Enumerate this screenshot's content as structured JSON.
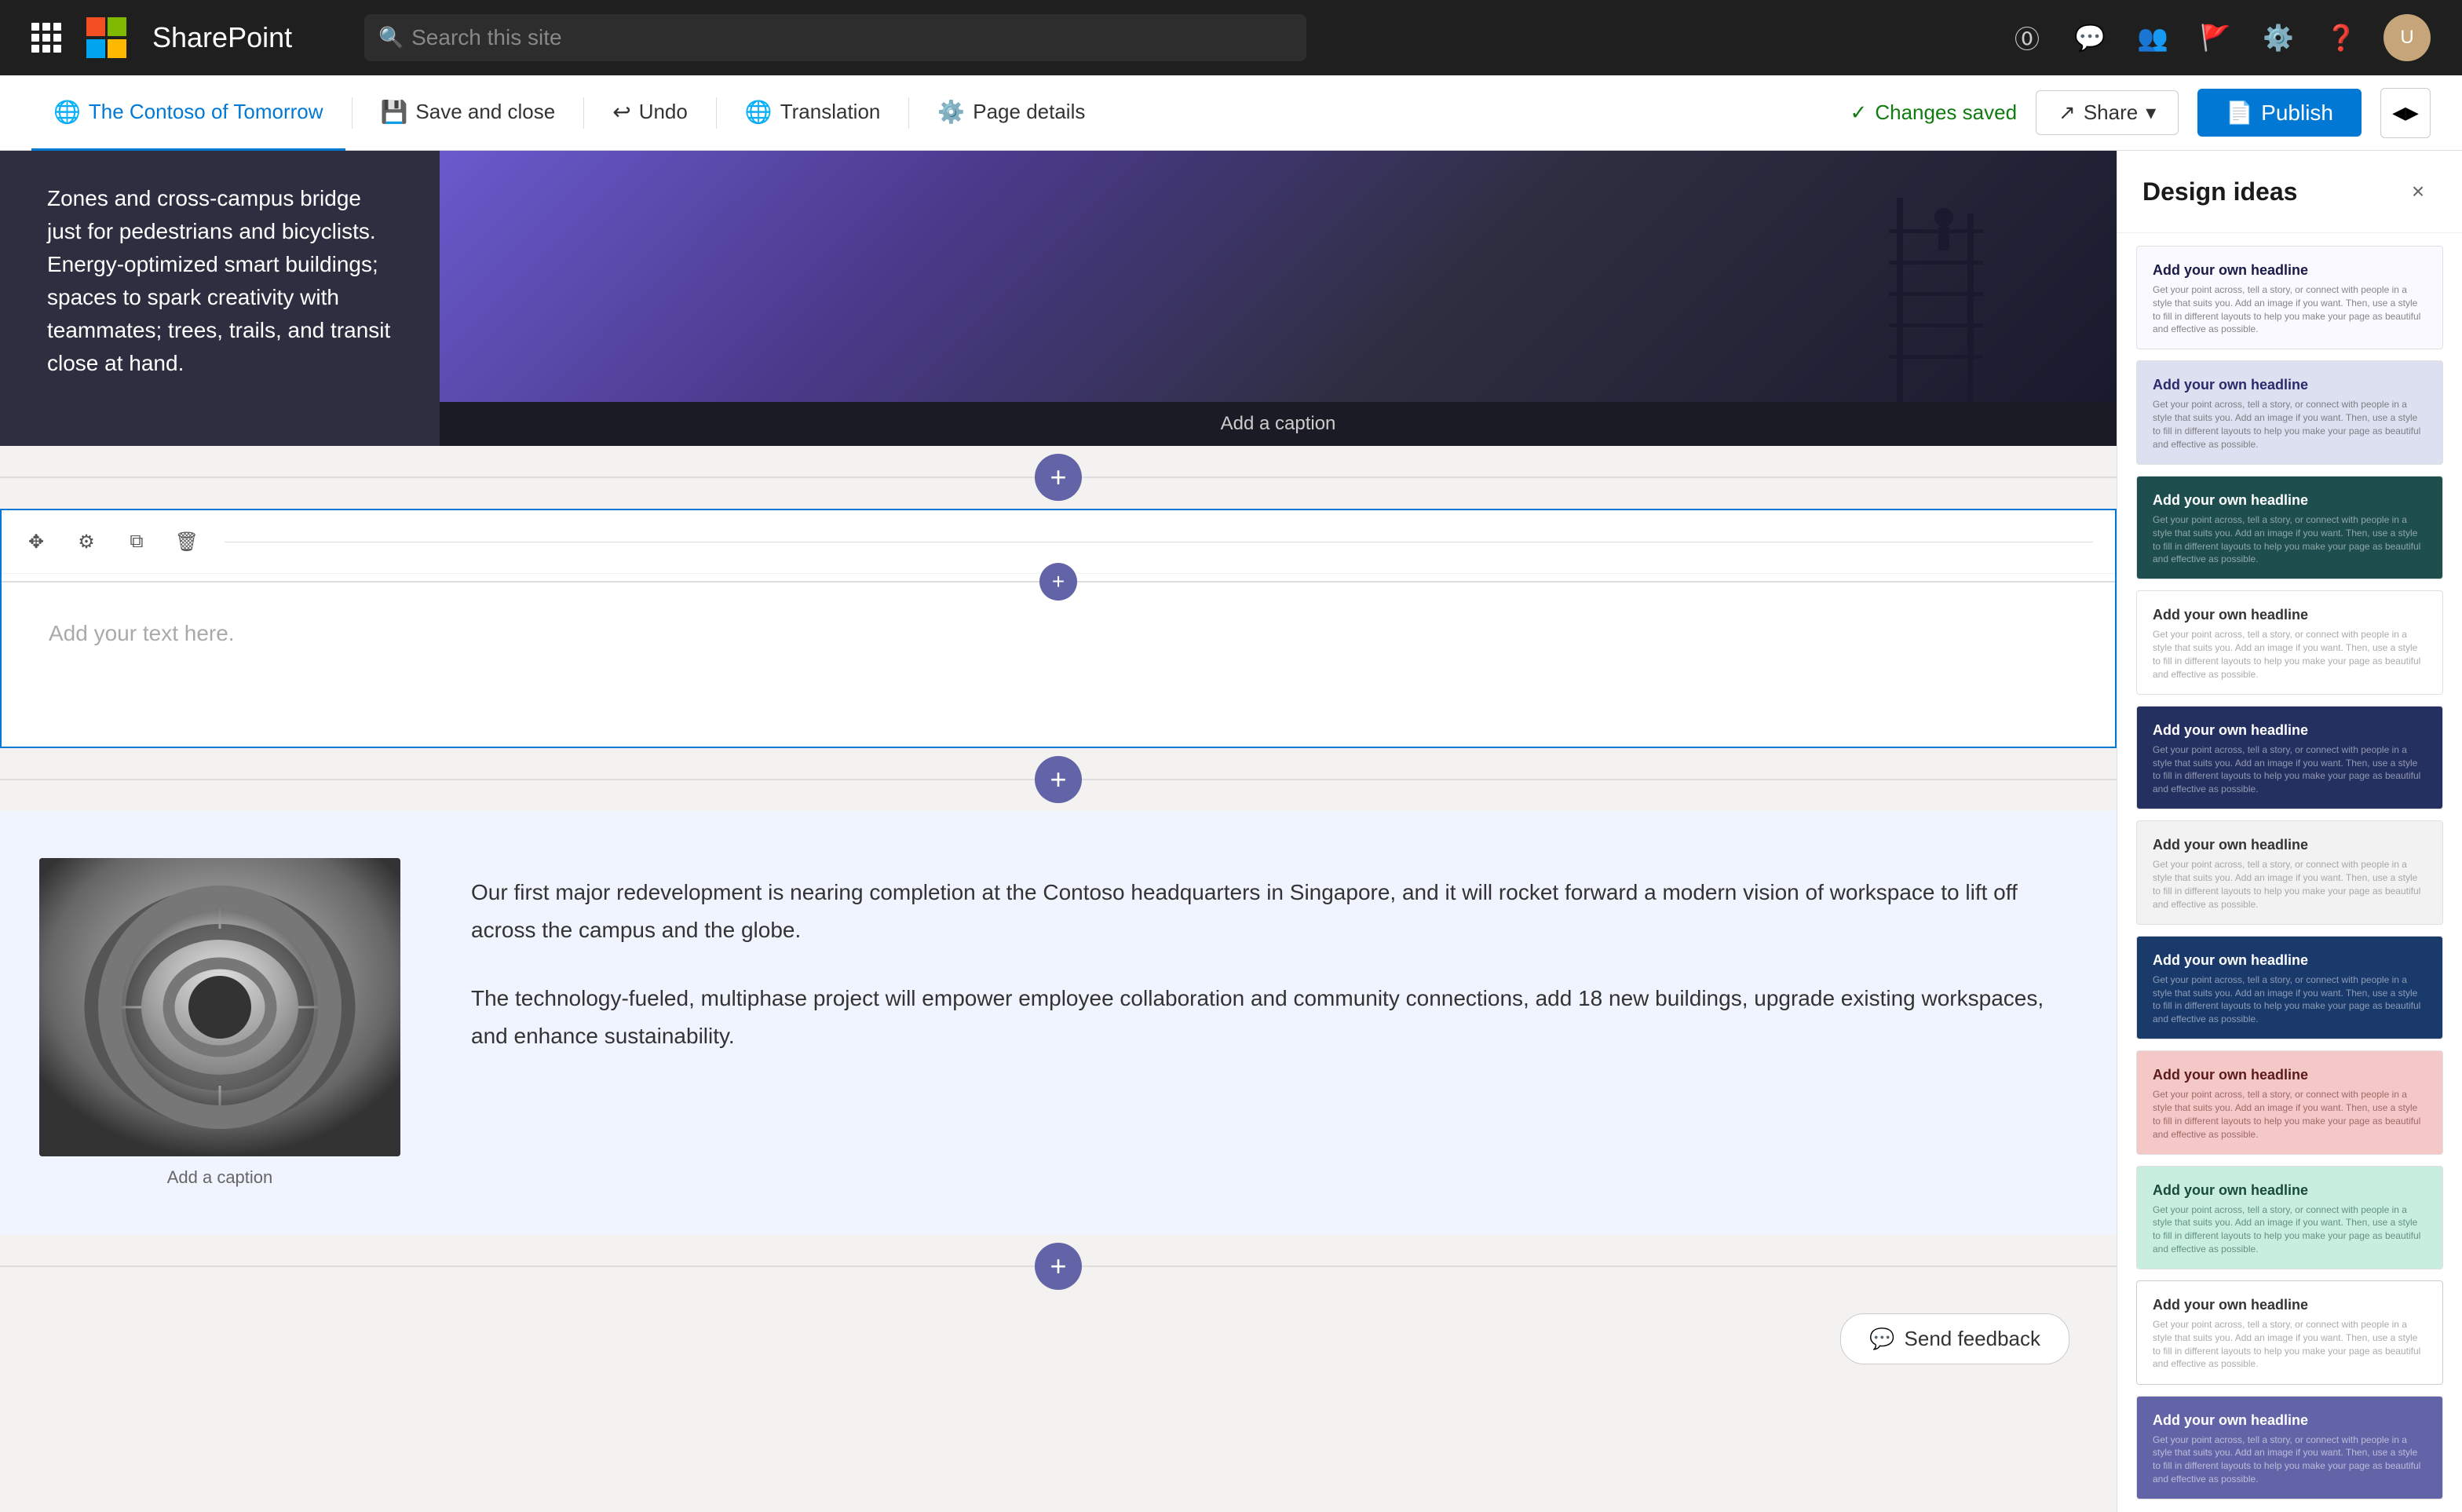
{
  "topnav": {
    "app_name": "SharePoint",
    "search_placeholder": "Search this site"
  },
  "toolbar": {
    "site_tab": "The Contoso of Tomorrow",
    "save_close_label": "Save and close",
    "undo_label": "Undo",
    "translation_label": "Translation",
    "page_details_label": "Page details",
    "changes_saved_label": "Changes saved",
    "share_label": "Share",
    "publish_label": "Publish"
  },
  "page": {
    "hero_text": "Zones and cross-campus bridge just for pedestrians and bicyclists. Energy-optimized smart buildings; spaces to spark creativity with teammates; trees, trails, and transit close at hand.",
    "hero_caption": "Add a caption",
    "text_placeholder": "Add your text here.",
    "bottom_caption": "Add a caption",
    "paragraph1": "Our first major redevelopment is nearing completion at the Contoso headquarters in Singapore, and it will rocket forward a modern vision of workspace to lift off across the campus and the globe.",
    "paragraph2": "The technology-fueled, multiphase project will empower employee collaboration and community connections, add 18 new buildings, upgrade existing workspaces, and enhance sustainability."
  },
  "design_panel": {
    "title": "Design ideas",
    "close_label": "×",
    "cards": [
      {
        "id": "card1",
        "style": "white",
        "headline": "Add your own headline",
        "text": "Get your point across, tell a story, or connect with people in a style that suits you. Add an image if you want. Then, use a style to fill in different layouts to help you make your page as beautiful and effective as possible."
      },
      {
        "id": "card2",
        "style": "lavender",
        "headline": "Add your own headline",
        "text": "Get your point across, tell a story, or connect with people in a style that suits you. Add an image if you want. Then, use a style to fill in different layouts to help you make your page as beautiful and effective as possible."
      },
      {
        "id": "card3",
        "style": "dark-teal",
        "headline": "Add your own headline",
        "text": "Get your point across, tell a story, or connect with people in a style that suits you. Add an image if you want. Then, use a style to fill in different layouts to help you make your page as beautiful and effective as possible."
      },
      {
        "id": "card4",
        "style": "white-2",
        "headline": "Add your own headline",
        "text": "Get your point across, tell a story, or connect with people in a style that suits you. Add an image if you want. Then, use a style to fill in different layouts to help you make your page as beautiful and effective as possible."
      },
      {
        "id": "card5",
        "style": "dark-blue",
        "headline": "Add your own headline",
        "text": "Get your point across, tell a story, or connect with people in a style that suits you. Add an image if you want. Then, use a style to fill in different layouts to help you make your page as beautiful and effective as possible."
      },
      {
        "id": "card6",
        "style": "white-3",
        "headline": "Add your own headline",
        "text": "Get your point across, tell a story, or connect with people in a style that suits you. Add an image if you want. Then, use a style to fill in different layouts to help you make your page as beautiful and effective as possible."
      },
      {
        "id": "card7",
        "style": "dark-navy",
        "headline": "Add your own headline",
        "text": "Get your point across, tell a story, or connect with people in a style that suits you. Add an image if you want. Then, use a style to fill in different layouts to help you make your page as beautiful and effective as possible."
      },
      {
        "id": "card8",
        "style": "pink",
        "headline": "Add your own headline",
        "text": "Get your point across, tell a story, or connect with people in a style that suits you. Add an image if you want. Then, use a style to fill in different layouts to help you make your page as beautiful and effective as possible."
      },
      {
        "id": "card9",
        "style": "teal-green",
        "headline": "Add your own headline",
        "text": "Get your point across, tell a story, or connect with people in a style that suits you. Add an image if you want. Then, use a style to fill in different layouts to help you make your page as beautiful and effective as possible."
      },
      {
        "id": "card10",
        "style": "white-4",
        "headline": "Add your own headline",
        "text": "Get your point across, tell a story, or connect with people in a style that suits you. Add an image if you want. Then, use a style to fill in different layouts to help you make your page as beautiful and effective as possible."
      },
      {
        "id": "card11",
        "style": "purple",
        "headline": "Add your own headline",
        "text": "Get your point across, tell a story, or connect with people in a style that suits you. Add an image if you want. Then, use a style to fill in different layouts to help you make your page as beautiful and effective as possible."
      }
    ]
  },
  "feedback": {
    "label": "Send feedback"
  }
}
